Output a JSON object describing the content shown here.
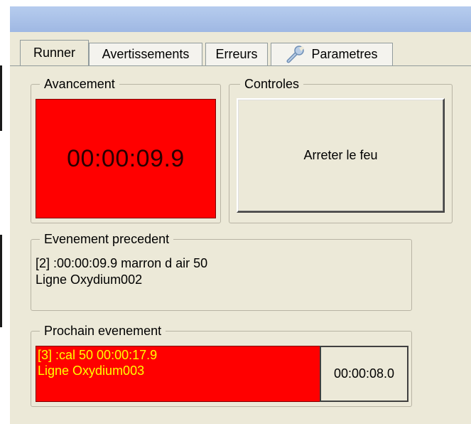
{
  "tabs": [
    {
      "label": "Runner",
      "active": true
    },
    {
      "label": "Avertissements",
      "active": false
    },
    {
      "label": "Erreurs",
      "active": false
    },
    {
      "label": "Parametres",
      "active": false,
      "icon": "wrench-icon"
    }
  ],
  "progress": {
    "legend": "Avancement",
    "elapsed": "00:00:09.9",
    "background_color": "#ff0000"
  },
  "controls": {
    "legend": "Controles",
    "stop_label": "Arreter le feu"
  },
  "previous_event": {
    "legend": "Evenement precedent",
    "line1": "[2] :00:00:09.9 marron d air 50",
    "line2": "Ligne Oxydium002"
  },
  "next_event": {
    "legend": "Prochain evenement",
    "line1": "[3] :cal 50 00:00:17.9",
    "line2": "Ligne Oxydium003",
    "countdown": "00:00:08.0",
    "background_color": "#ff0000",
    "text_color": "#ffff00"
  }
}
